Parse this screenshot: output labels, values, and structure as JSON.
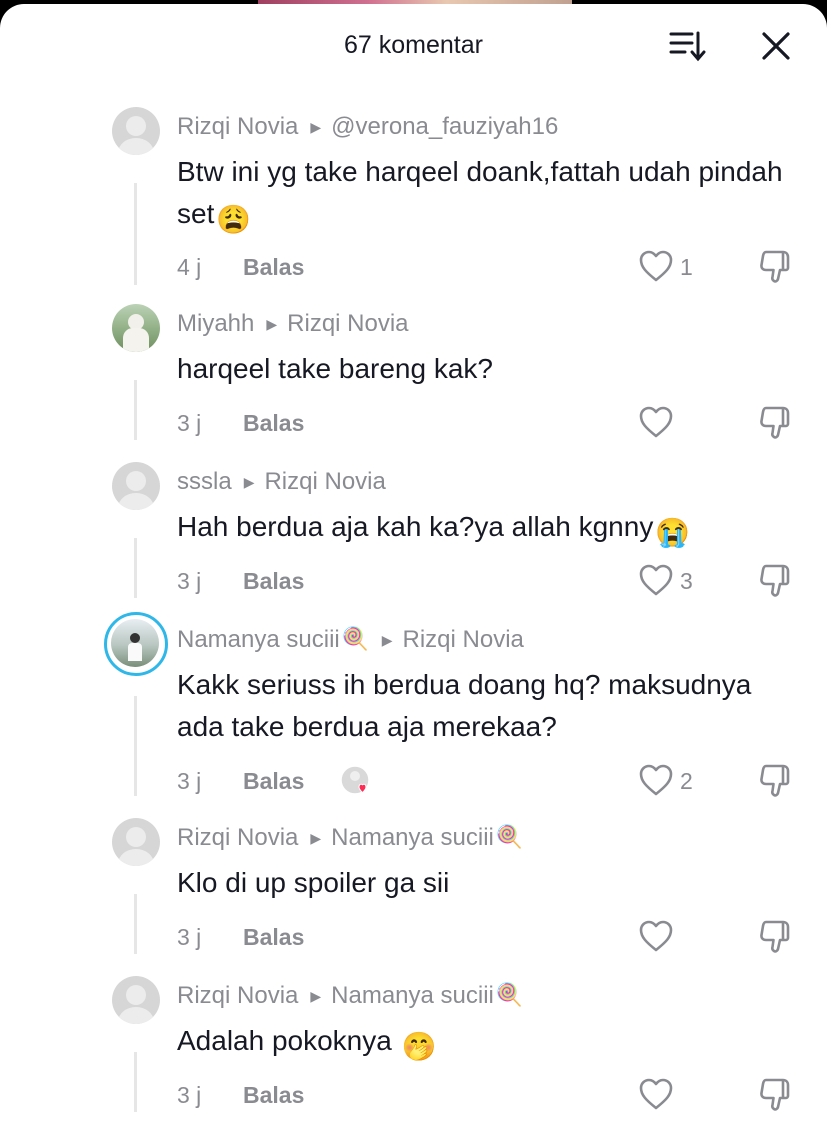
{
  "header": {
    "title": "67 komentar"
  },
  "icons": {
    "sort": "sort-icon",
    "close": "close-icon",
    "like": "heart-outline-icon",
    "dislike": "thumbs-down-icon"
  },
  "comments": [
    {
      "author": "Rizqi Novia",
      "reply_to": "@verona_fauziyah16",
      "text": "Btw ini yg take harqeel doank,fattah udah pindah set",
      "emoji": "😩",
      "time": "4 j",
      "reply_label": "Balas",
      "likes": "1"
    },
    {
      "author": "Miyahh",
      "reply_to": "Rizqi Novia",
      "text": "harqeel take bareng kak?",
      "emoji": "",
      "time": "3 j",
      "reply_label": "Balas",
      "likes": ""
    },
    {
      "author": "sssla",
      "reply_to": "Rizqi Novia",
      "text": "Hah berdua aja kah ka?ya allah kgnny",
      "emoji": "😭",
      "time": "3 j",
      "reply_label": "Balas",
      "likes": "3"
    },
    {
      "author": "Namanya suciii",
      "author_emoji": "🍭",
      "reply_to": "Rizqi Novia",
      "text": "Kakk seriuss ih berdua doang hq? maksudnya ada take berdua aja merekaa?",
      "emoji": "",
      "time": "3 j",
      "reply_label": "Balas",
      "likes": "2"
    },
    {
      "author": "Rizqi Novia",
      "reply_to": "Namanya suciii",
      "reply_to_emoji": "🍭",
      "text": "Klo di up spoiler ga sii",
      "emoji": "",
      "time": "3 j",
      "reply_label": "Balas",
      "likes": ""
    },
    {
      "author": "Rizqi Novia",
      "reply_to": "Namanya suciii",
      "reply_to_emoji": "🍭",
      "text": "Adalah pokoknya ",
      "emoji": "🤭",
      "time": "3 j",
      "reply_label": "Balas",
      "likes": ""
    }
  ]
}
